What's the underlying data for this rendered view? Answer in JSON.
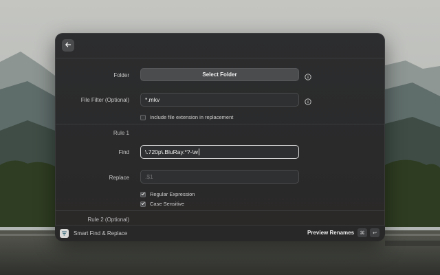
{
  "window": {
    "folder": {
      "label": "Folder",
      "button_label": "Select Folder"
    },
    "file_filter": {
      "label": "File Filter (Optional)",
      "value": "*.mkv"
    },
    "include_extension": {
      "label": "Include file extension in replacement",
      "checked": false
    },
    "rule1": {
      "title": "Rule 1",
      "find_label": "Find",
      "find_value": "\\.720p\\.BluRay.*?-\\w",
      "replace_label": "Replace",
      "replace_placeholder": ".$1",
      "regular_expression": {
        "label": "Regular Expression",
        "checked": true
      },
      "case_sensitive": {
        "label": "Case Sensitive",
        "checked": true
      }
    },
    "rule2": {
      "title": "Rule 2 (Optional)"
    }
  },
  "footer": {
    "app_name": "Smart Find & Replace",
    "preview_label": "Preview Renames",
    "shortcut_keys": [
      "⌘",
      "↩"
    ]
  },
  "icons": {
    "back": "arrow-left-icon",
    "info": "info-circle-icon",
    "check": "checkmark-icon",
    "app": "filter-icon"
  }
}
